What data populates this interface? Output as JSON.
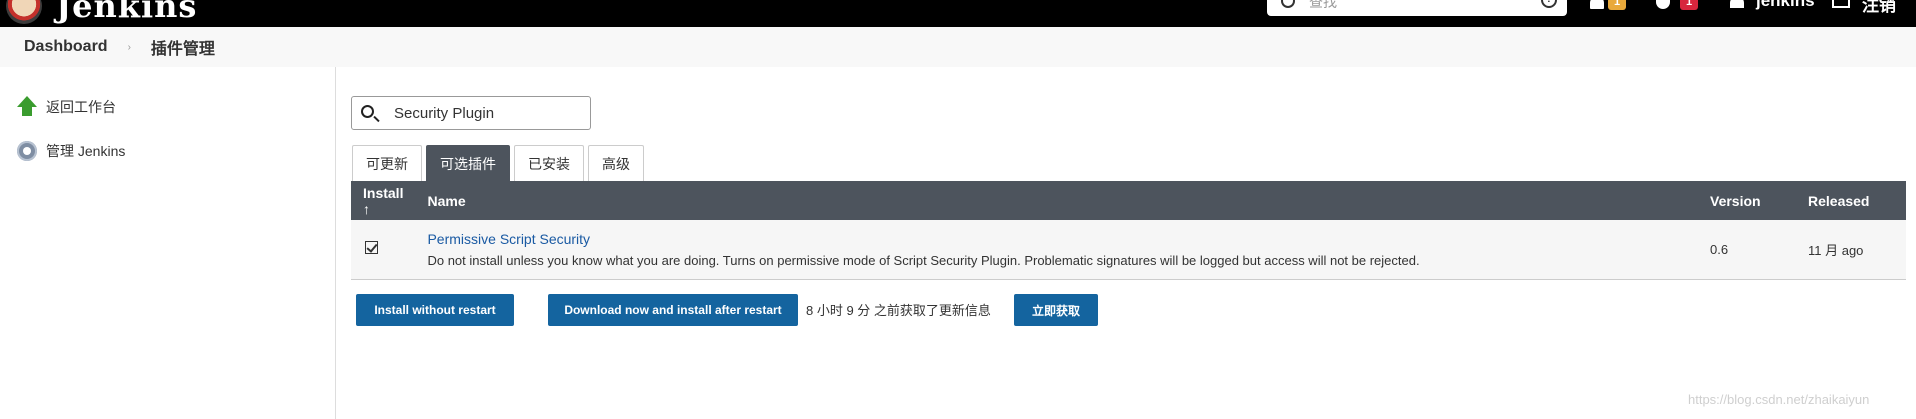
{
  "header": {
    "app_name": "Jenkins",
    "search_placeholder": "查找",
    "help_glyph": "?",
    "notifications_count": "1",
    "security_count": "1",
    "user_name": "jenkins",
    "logout_label": "注销"
  },
  "breadcrumb": {
    "items": [
      "Dashboard",
      "插件管理"
    ],
    "separator": "›"
  },
  "sidebar": {
    "items": [
      {
        "label": "返回工作台",
        "icon": "arrow-up-icon"
      },
      {
        "label": "管理 Jenkins",
        "icon": "gear-icon"
      }
    ]
  },
  "plugin_search": {
    "value": "Security Plugin"
  },
  "tabs": [
    {
      "label": "可更新",
      "active": false
    },
    {
      "label": "可选插件",
      "active": true
    },
    {
      "label": "已安装",
      "active": false
    },
    {
      "label": "高级",
      "active": false
    }
  ],
  "table": {
    "columns": [
      "Install ↑",
      "Name",
      "Version",
      "Released"
    ],
    "rows": [
      {
        "checked": true,
        "name": "Permissive Script Security",
        "description": "Do not install unless you know what you are doing. Turns on permissive mode of Script Security Plugin. Problematic signatures will be logged but access will not be rejected.",
        "version": "0.6",
        "released": "11 月 ago"
      }
    ]
  },
  "actions": {
    "install_without_restart": "Install without restart",
    "download_install_after_restart": "Download now and install after restart",
    "update_info": "8 小时 9 分 之前获取了更新信息",
    "fetch_now": "立即获取"
  },
  "watermark": "https://blog.csdn.net/zhaikaiyun",
  "colors": {
    "header_bg": "#000000",
    "table_header_bg": "#4d545d",
    "active_tab_bg": "#4d545d",
    "button_bg": "#14649f",
    "link": "#1a5aa3"
  }
}
